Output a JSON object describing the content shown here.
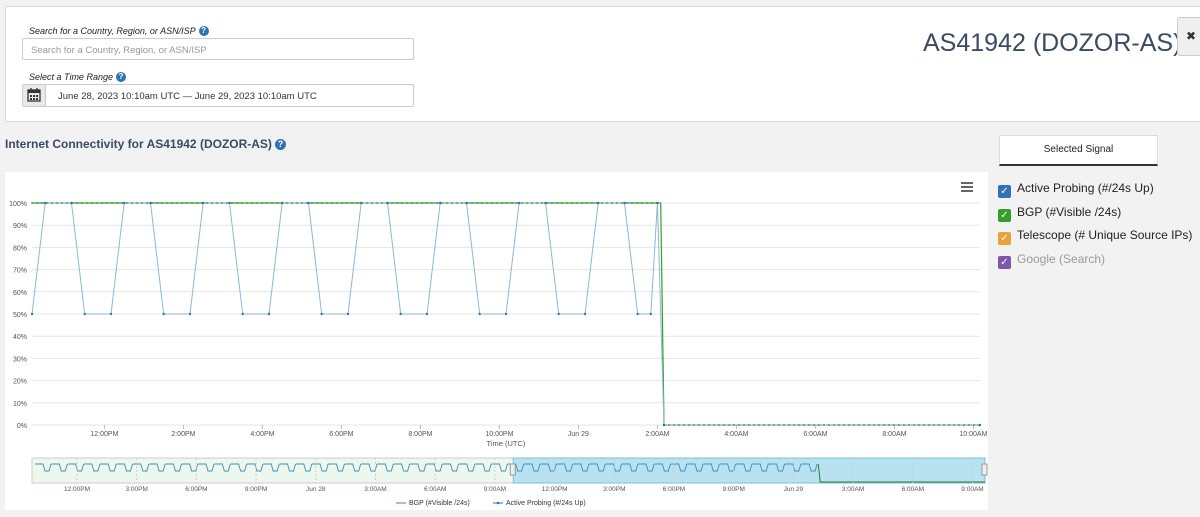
{
  "search": {
    "label": "Search for a Country, Region, or ASN/ISP",
    "placeholder": "Search for a Country, Region, or ASN/ISP"
  },
  "time_range": {
    "label": "Select a Time Range",
    "value": "June 28, 2023 10:10am UTC — June 29, 2023 10:10am UTC"
  },
  "entity_title": "AS41942 (DOZOR-AS)",
  "help_glyph": "?",
  "section_title": "Internet Connectivity for AS41942 (DOZOR-AS)",
  "signal_tab": "Selected Signal",
  "legend": [
    {
      "label": "Active Probing (#/24s Up)",
      "color": "#2f73b4",
      "checked": true
    },
    {
      "label": "BGP (#Visible /24s)",
      "color": "#33a02c",
      "checked": true
    },
    {
      "label": "Telescope (# Unique Source IPs)",
      "color": "#e8a33d",
      "checked": true
    },
    {
      "label": "Google (Search)",
      "color": "#6a3d9a",
      "checked": true,
      "muted": true
    }
  ],
  "chart_data": {
    "type": "line",
    "xlabel": "Time (UTC)",
    "y_ticks": [
      "0%",
      "10%",
      "20%",
      "30%",
      "40%",
      "50%",
      "60%",
      "70%",
      "80%",
      "90%",
      "100%"
    ],
    "x_ticks": [
      "12:00PM",
      "2:00PM",
      "4:00PM",
      "6:00PM",
      "8:00PM",
      "10:00PM",
      "Jun 29",
      "2:00AM",
      "4:00AM",
      "6:00AM",
      "8:00AM",
      "10:00AM"
    ],
    "x_range": [
      "2023-06-28 10:10",
      "2023-06-29 10:10"
    ],
    "ylim": [
      0,
      100
    ],
    "series": [
      {
        "name": "BGP (#Visible /24s)",
        "color": "#33a02c",
        "values_note_free": true,
        "segments": [
          {
            "from": "2023-06-28 10:10",
            "to": "2023-06-29 02:05",
            "value": 100
          },
          {
            "from": "2023-06-29 02:10",
            "to": "2023-06-29 10:10",
            "value": 0
          }
        ]
      },
      {
        "name": "Active Probing (#/24s Up)",
        "color": "#2f73b4",
        "pattern": [
          [
            "2023-06-28 10:10",
            50
          ],
          [
            "2023-06-28 10:30",
            100
          ],
          [
            "2023-06-28 11:10",
            100
          ],
          [
            "2023-06-28 11:30",
            50
          ],
          [
            "2023-06-28 12:10",
            50
          ],
          [
            "2023-06-28 12:30",
            100
          ],
          [
            "2023-06-28 13:10",
            100
          ],
          [
            "2023-06-28 13:30",
            50
          ],
          [
            "2023-06-28 14:10",
            50
          ],
          [
            "2023-06-28 14:30",
            100
          ],
          [
            "2023-06-28 15:10",
            100
          ],
          [
            "2023-06-28 15:30",
            50
          ],
          [
            "2023-06-28 16:10",
            50
          ],
          [
            "2023-06-28 16:30",
            100
          ],
          [
            "2023-06-28 17:10",
            100
          ],
          [
            "2023-06-28 17:30",
            50
          ],
          [
            "2023-06-28 18:10",
            50
          ],
          [
            "2023-06-28 18:30",
            100
          ],
          [
            "2023-06-28 19:10",
            100
          ],
          [
            "2023-06-28 19:30",
            50
          ],
          [
            "2023-06-28 20:10",
            50
          ],
          [
            "2023-06-28 20:30",
            100
          ],
          [
            "2023-06-28 21:10",
            100
          ],
          [
            "2023-06-28 21:30",
            50
          ],
          [
            "2023-06-28 22:10",
            50
          ],
          [
            "2023-06-28 22:30",
            100
          ],
          [
            "2023-06-28 23:10",
            100
          ],
          [
            "2023-06-28 23:30",
            50
          ],
          [
            "2023-06-29 00:10",
            50
          ],
          [
            "2023-06-29 00:30",
            100
          ],
          [
            "2023-06-29 01:10",
            100
          ],
          [
            "2023-06-29 01:30",
            50
          ],
          [
            "2023-06-29 01:50",
            50
          ],
          [
            "2023-06-29 02:00",
            100
          ],
          [
            "2023-06-29 02:10",
            0
          ],
          [
            "2023-06-29 10:10",
            0
          ]
        ]
      }
    ],
    "navigator": {
      "x_ticks": [
        "12:00PM",
        "3:00PM",
        "6:00PM",
        "9:00PM",
        "Jun 28",
        "3:00AM",
        "6:00AM",
        "9:00AM",
        "12:00PM",
        "3:00PM",
        "6:00PM",
        "9:00PM",
        "Jun 29",
        "3:00AM",
        "6:00AM",
        "9:00AM"
      ],
      "selected_range": [
        "2023-06-28 10:10",
        "2023-06-29 10:10"
      ]
    },
    "bottom_legend": [
      "BGP (#Visible /24s)",
      "Active Probing (#/24s Up)"
    ]
  }
}
